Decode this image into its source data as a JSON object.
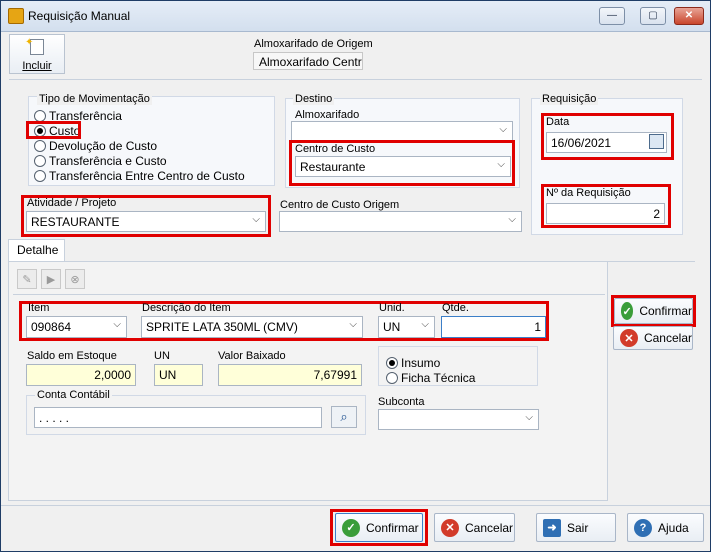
{
  "window": {
    "title": "Requisição Manual",
    "minimize": "—",
    "maximize": "▢",
    "close": "✕"
  },
  "toolbar": {
    "incluir_label": "Incluir"
  },
  "almox_origem": {
    "label": "Almoxarifado de Origem",
    "value": "Almoxarifado Central"
  },
  "tipo_mov": {
    "label": "Tipo de Movimentação",
    "options": [
      "Transferência",
      "Custo",
      "Devolução de Custo",
      "Transferência e Custo",
      "Transferência Entre Centro de Custo"
    ],
    "selected": "Custo"
  },
  "destino": {
    "label": "Destino",
    "almox_label": "Almoxarifado",
    "almox_value": "",
    "cc_label": "Centro de Custo",
    "cc_value": "Restaurante"
  },
  "requisicao": {
    "label": "Requisição",
    "data_label": "Data",
    "data_value": "16/06/2021",
    "numero_label": "Nº  da Requisição",
    "numero_value": "2"
  },
  "atividade": {
    "label": "Atividade / Projeto",
    "value": "RESTAURANTE"
  },
  "cc_origem": {
    "label": "Centro de Custo Origem",
    "value": ""
  },
  "tabs": [
    "Detalhe"
  ],
  "detalhe": {
    "item_label": "Item",
    "item_value": "090864",
    "desc_label": "Descrição do Item",
    "desc_value": "SPRITE LATA 350ML (CMV)",
    "unid_label": "Unid.",
    "unid_value": "UN",
    "qtde_label": "Qtde.",
    "qtde_value": "1",
    "saldo_label": "Saldo em Estoque",
    "saldo_value": "2,0000",
    "un_label": "UN",
    "un_value": "UN",
    "valor_label": "Valor Baixado",
    "valor_value": "7,67991",
    "insumo_label": "Insumo",
    "ficha_label": "Ficha Técnica",
    "conta_label": "Conta Contábil",
    "conta_value": ". . . . .",
    "subconta_label": "Subconta",
    "subconta_value": ""
  },
  "side_buttons": {
    "confirmar": "Confirmar",
    "cancelar": "Cancelar"
  },
  "footer": {
    "confirmar": "Confirmar",
    "cancelar": "Cancelar",
    "sair": "Sair",
    "ajuda": "Ajuda"
  }
}
